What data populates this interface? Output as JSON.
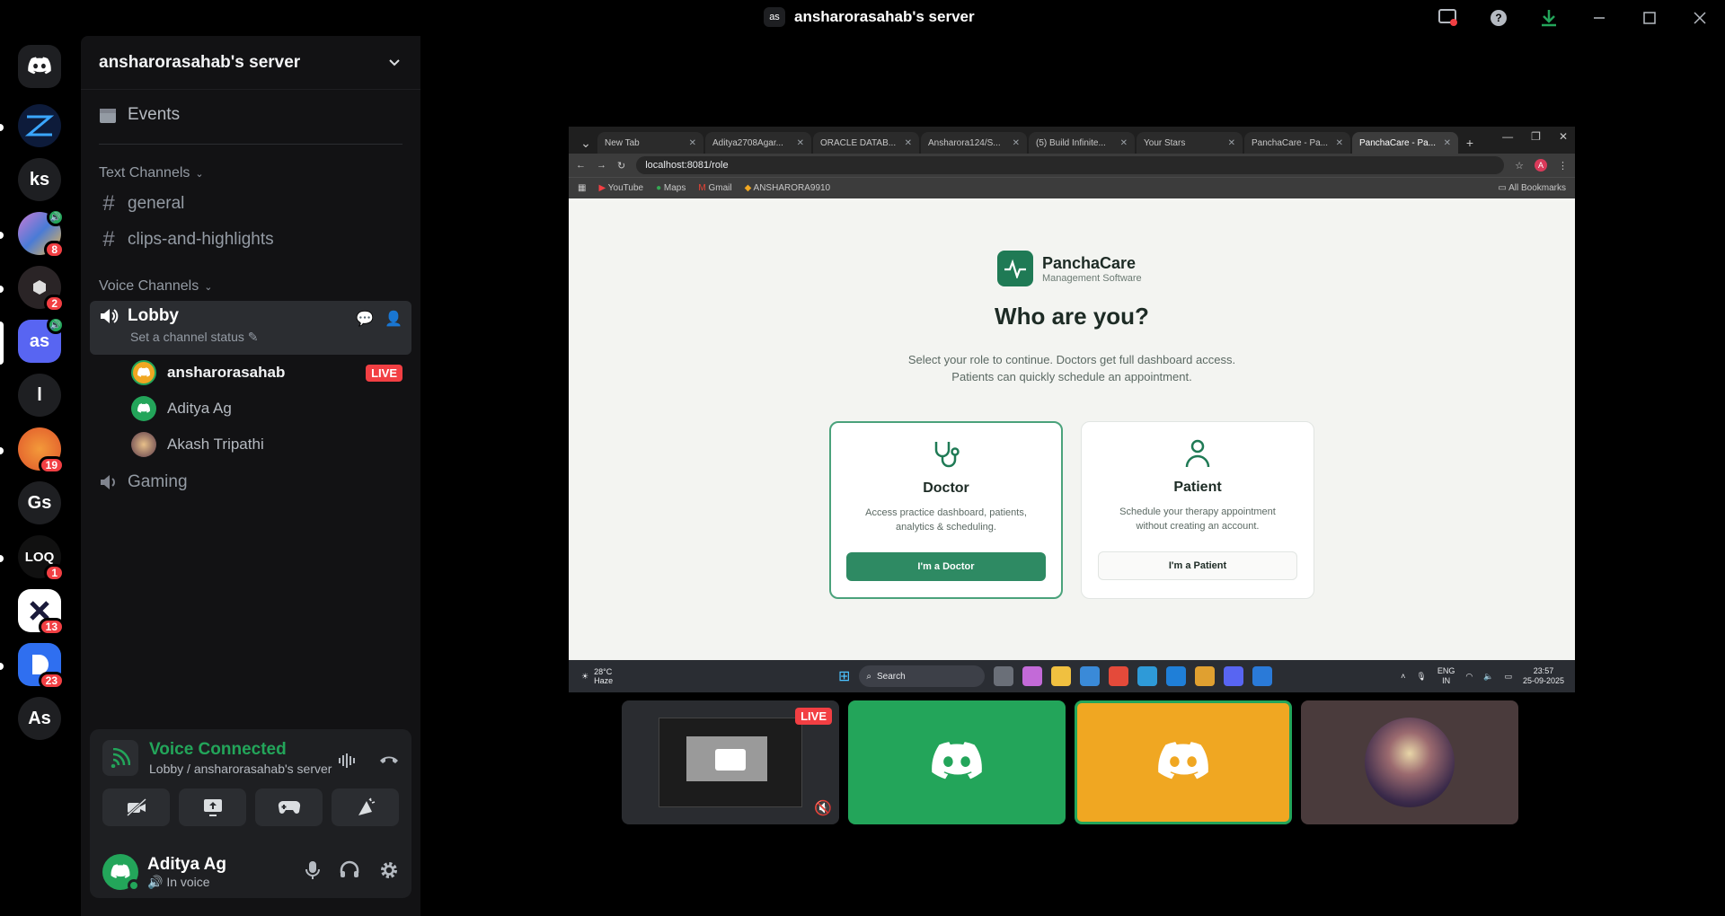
{
  "titlebar": {
    "badge": "as",
    "title": "ansharorasahab's server",
    "icons": [
      "screen-share-icon",
      "help-icon",
      "download-icon",
      "minimize-icon",
      "maximize-icon",
      "close-icon"
    ]
  },
  "rail": {
    "servers": [
      {
        "label": "",
        "icon": "discord-icon"
      },
      {
        "label": "",
        "badge": "",
        "icon": "zc-logo"
      },
      {
        "label": "ks"
      },
      {
        "label": "",
        "badge": "8",
        "icon": "colorful-server"
      },
      {
        "label": "",
        "badge": "2",
        "icon": "dark-server"
      },
      {
        "label": "as",
        "active": true
      },
      {
        "label": "l"
      },
      {
        "label": "",
        "badge": "19",
        "icon": "orange-server"
      },
      {
        "label": "Gs"
      },
      {
        "label": "LOQ",
        "badge": "1",
        "icon": "lenovo-server"
      },
      {
        "label": "",
        "badge": "13",
        "icon": "x-server"
      },
      {
        "label": "",
        "badge": "23",
        "icon": "blue-server"
      },
      {
        "label": "As"
      }
    ]
  },
  "sidebar": {
    "server_name": "ansharorasahab's server",
    "events_label": "Events",
    "text_category": "Text Channels",
    "text_channels": [
      "general",
      "clips-and-highlights"
    ],
    "voice_category": "Voice Channels",
    "lobby": {
      "name": "Lobby",
      "status": "Set a channel status"
    },
    "members": [
      {
        "name": "ansharorasahab",
        "live": "LIVE"
      },
      {
        "name": "Aditya Ag"
      },
      {
        "name": "Akash Tripathi"
      }
    ],
    "gaming": "Gaming"
  },
  "voice_panel": {
    "title": "Voice Connected",
    "subtitle": "Lobby / ansharorasahab's server"
  },
  "user": {
    "name": "Aditya Ag",
    "status": "In voice"
  },
  "browser": {
    "tabs": [
      "New Tab",
      "Aditya2708Agar...",
      "ORACLE DATAB...",
      "Ansharora124/S...",
      "(5) Build Infinite...",
      "Your Stars",
      "PanchaCare - Pa...",
      "PanchaCare - Pa..."
    ],
    "url": "localhost:8081/role",
    "bookmarks": [
      "YouTube",
      "Maps",
      "Gmail",
      "ANSHARORA9910"
    ],
    "all_bookmarks": "All Bookmarks"
  },
  "app": {
    "brand": "PanchaCare",
    "brand_sub": "Management Software",
    "heading": "Who are you?",
    "sub1": "Select your role to continue. Doctors get full dashboard access.",
    "sub2": "Patients can quickly schedule an appointment.",
    "doctor": {
      "title": "Doctor",
      "desc": "Access practice dashboard, patients, analytics & scheduling.",
      "button": "I'm a Doctor"
    },
    "patient": {
      "title": "Patient",
      "desc": "Schedule your therapy appointment without creating an account.",
      "button": "I'm a Patient"
    }
  },
  "taskbar": {
    "temp": "28°C",
    "weather": "Haze",
    "search": "Search",
    "lang1": "ENG",
    "lang2": "IN",
    "time": "23:57",
    "date": "25-09-2025"
  },
  "tiles": {
    "live": "LIVE"
  }
}
